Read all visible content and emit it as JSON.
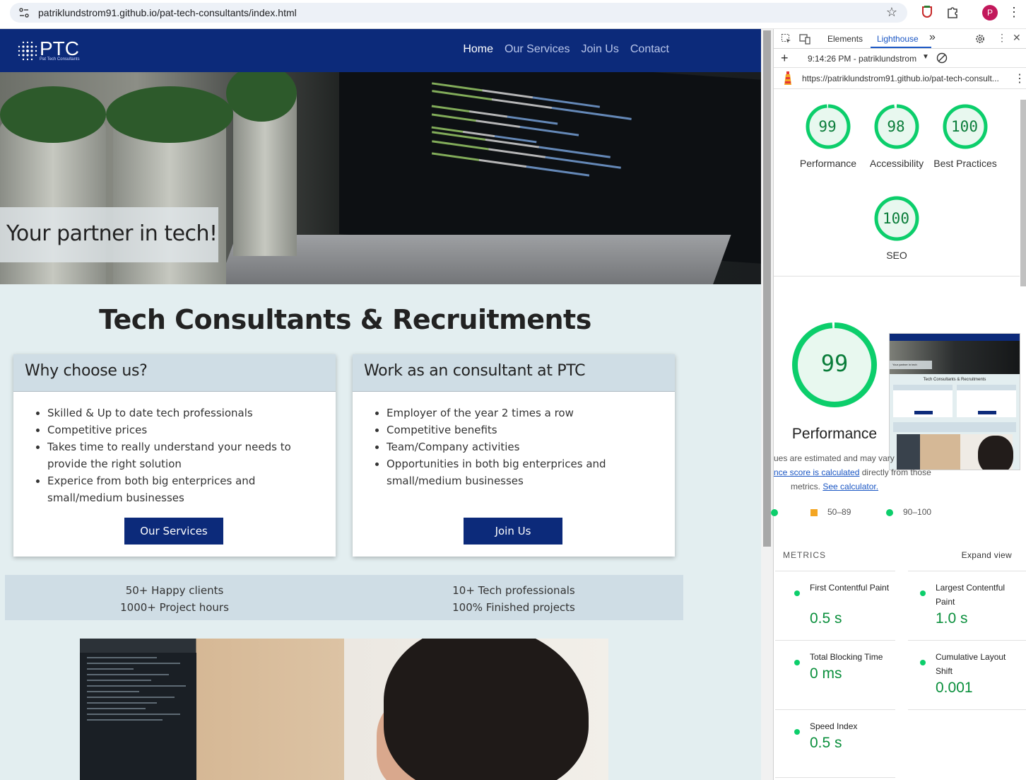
{
  "browser": {
    "url": "patriklundstrom91.github.io/pat-tech-consultants/index.html",
    "avatar_letter": "P"
  },
  "site": {
    "logo_text": "PTC",
    "logo_subtext": "Pat Tech Consultants",
    "nav": [
      "Home",
      "Our Services",
      "Join Us",
      "Contact"
    ],
    "hero_caption": "Your partner in tech!",
    "heading": "Tech Consultants & Recruitments",
    "card_left": {
      "title": "Why choose us?",
      "items": [
        "Skilled & Up to date tech professionals",
        "Competitive prices",
        "Takes time to really understand your needs to provide the right solution",
        "Experice from both big enterprices and small/medium businesses"
      ],
      "button": "Our Services"
    },
    "card_right": {
      "title": "Work as an consultant at PTC",
      "items": [
        "Employer of the year 2 times a row",
        "Competitive benefits",
        "Team/Company activities",
        "Opportunities in both big enterprices and small/medium businesses"
      ],
      "button": "Join Us"
    },
    "stats_left": [
      "50+ Happy clients",
      "1000+ Project hours"
    ],
    "stats_right": [
      "10+ Tech professionals",
      "100% Finished projects"
    ]
  },
  "devtools": {
    "tabs": [
      "Elements",
      "Lighthouse"
    ],
    "more_tabs": "»",
    "report_time": "9:14:26 PM - patriklundstrom",
    "report_url": "https://patriklundstrom91.github.io/pat-tech-consult...",
    "scores": [
      {
        "label": "Performance",
        "value": 99
      },
      {
        "label": "Accessibility",
        "value": 98
      },
      {
        "label": "Best Practices",
        "value": 100
      },
      {
        "label": "SEO",
        "value": 100
      }
    ],
    "big_score": {
      "label": "Performance",
      "value": 99
    },
    "thumb_caption": "Your partner in tech",
    "thumb_title": "Tech Consultants & Recruitments",
    "note_line1": "ues are estimated and may vary",
    "note_link1": "nce score is calculated",
    "note_line2": " directly from those",
    "note_line3": "metrics. ",
    "note_link2": "See calculator.",
    "legend_mid": "50–89",
    "legend_high": "90–100",
    "metrics_label": "METRICS",
    "expand_view": "Expand view",
    "metrics": [
      {
        "name": "First Contentful Paint",
        "value": "0.5 s"
      },
      {
        "name": "Largest Contentful Paint",
        "value": "1.0 s"
      },
      {
        "name": "Total Blocking Time",
        "value": "0 ms"
      },
      {
        "name": "Cumulative Layout Shift",
        "value": "0.001"
      },
      {
        "name": "Speed Index",
        "value": "0.5 s"
      }
    ],
    "colors": {
      "pass": "#0cce6b",
      "average": "#f4a623",
      "accent": "#1a56c4"
    }
  }
}
